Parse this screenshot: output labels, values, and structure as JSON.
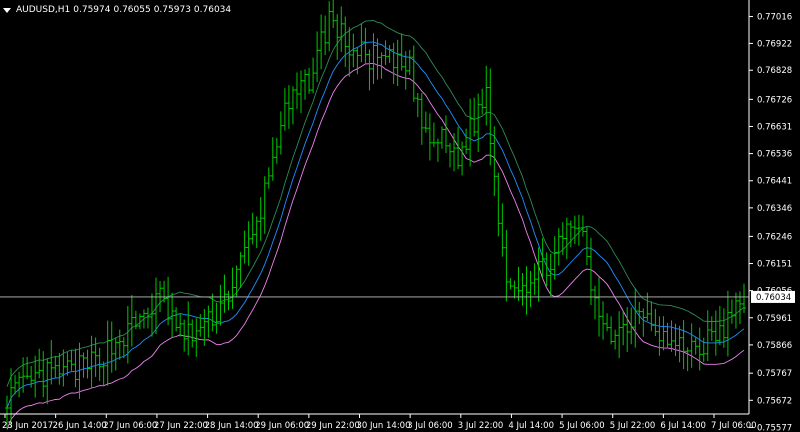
{
  "header": {
    "symbol": "AUDUSD,H1",
    "open": "0.75974",
    "high": "0.76055",
    "low": "0.75973",
    "close": "0.76034",
    "dropdown_icon": "triangle-down-icon"
  },
  "chart_data": {
    "type": "ohlc",
    "symbol": "AUDUSD",
    "timeframe": "H1",
    "ylim": [
      0.75624,
      0.7706
    ],
    "price_ticks": [
      "0.77016",
      "0.76922",
      "0.76828",
      "0.76726",
      "0.76631",
      "0.76536",
      "0.76441",
      "0.76346",
      "0.76246",
      "0.76151",
      "0.76056",
      "0.75961",
      "0.75866",
      "0.75767",
      "0.75672",
      "0.75577"
    ],
    "current_price": "0.76034",
    "time_ticks": [
      "23 Jun 2017",
      "26 Jun 14:00",
      "27 Jun 06:00",
      "27 Jun 22:00",
      "28 Jun 14:00",
      "29 Jun 06:00",
      "29 Jun 22:00",
      "30 Jun 14:00",
      "3 Jul 06:00",
      "3 Jul 22:00",
      "4 Jul 14:00",
      "5 Jul 06:00",
      "5 Jul 22:00",
      "6 Jul 14:00",
      "7 Jul 06:00"
    ],
    "bar_count": 184,
    "price_path": [
      [
        0,
        0.7569
      ],
      [
        10,
        0.7576
      ],
      [
        20,
        0.7579
      ],
      [
        30,
        0.7591
      ],
      [
        38,
        0.7603
      ],
      [
        44,
        0.7589
      ],
      [
        50,
        0.7594
      ],
      [
        55,
        0.7605
      ],
      [
        62,
        0.7628
      ],
      [
        68,
        0.7665
      ],
      [
        75,
        0.768
      ],
      [
        80,
        0.7701
      ],
      [
        86,
        0.7689
      ],
      [
        94,
        0.7686
      ],
      [
        100,
        0.7683
      ],
      [
        104,
        0.7658
      ],
      [
        108,
        0.7658
      ],
      [
        112,
        0.7652
      ],
      [
        116,
        0.7665
      ],
      [
        119,
        0.7675
      ],
      [
        121,
        0.7645
      ],
      [
        124,
        0.761
      ],
      [
        130,
        0.7608
      ],
      [
        136,
        0.7619
      ],
      [
        142,
        0.763
      ],
      [
        146,
        0.76
      ],
      [
        151,
        0.759
      ],
      [
        158,
        0.76
      ],
      [
        165,
        0.7586
      ],
      [
        172,
        0.7586
      ],
      [
        178,
        0.7592
      ],
      [
        183,
        0.7603
      ]
    ],
    "indicators": {
      "moving_average": "blue",
      "envelope_upper": "green",
      "envelope_lower": "violet"
    },
    "colors": {
      "background": "#000000",
      "bars": "#00c800",
      "moving_average": "#1e90ff",
      "envelope_upper": "#2e8b57",
      "envelope_lower": "#ee82ee",
      "price_line": "#c0c0c0",
      "axis": "#ffffff"
    },
    "grid": false
  }
}
